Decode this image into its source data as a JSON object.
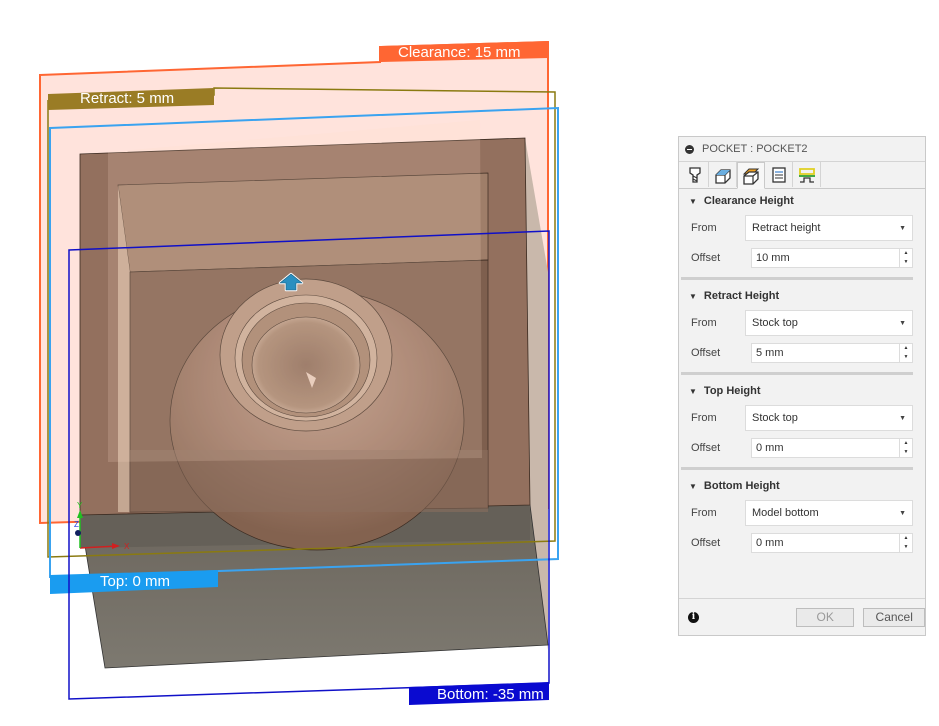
{
  "viewport": {
    "planes": {
      "clearance": {
        "label": "Clearance: 15 mm",
        "color": "#ff6633"
      },
      "retract": {
        "label": "Retract: 5 mm",
        "color": "#9a7c25"
      },
      "top": {
        "label": "Top: 0 mm",
        "color": "#1a9cf0"
      },
      "bottom": {
        "label": "Bottom: -35 mm",
        "color": "#0a0ad0"
      }
    },
    "axes": {
      "x": "X",
      "y": "Y",
      "z": "Z"
    },
    "icons": [
      "toolpath-direction-arrow-icon",
      "axis-triad-icon"
    ]
  },
  "panel": {
    "title": "POCKET : POCKET2",
    "tabs": [
      {
        "name": "tool-tab",
        "icon": "tool-icon",
        "active": false
      },
      {
        "name": "geometry-tab",
        "icon": "geometry-icon",
        "active": false
      },
      {
        "name": "heights-tab",
        "icon": "heights-icon",
        "active": true
      },
      {
        "name": "passes-tab",
        "icon": "passes-icon",
        "active": false
      },
      {
        "name": "linking-tab",
        "icon": "linking-icon",
        "active": false
      }
    ],
    "groups": [
      {
        "title": "Clearance Height",
        "from_label": "From",
        "from_value": "Retract height",
        "offset_label": "Offset",
        "offset_value": "10 mm"
      },
      {
        "title": "Retract Height",
        "from_label": "From",
        "from_value": "Stock top",
        "offset_label": "Offset",
        "offset_value": "5 mm"
      },
      {
        "title": "Top Height",
        "from_label": "From",
        "from_value": "Stock top",
        "offset_label": "Offset",
        "offset_value": "0 mm"
      },
      {
        "title": "Bottom Height",
        "from_label": "From",
        "from_value": "Model bottom",
        "offset_label": "Offset",
        "offset_value": "0 mm"
      }
    ],
    "footer": {
      "ok": "OK",
      "cancel": "Cancel"
    }
  }
}
